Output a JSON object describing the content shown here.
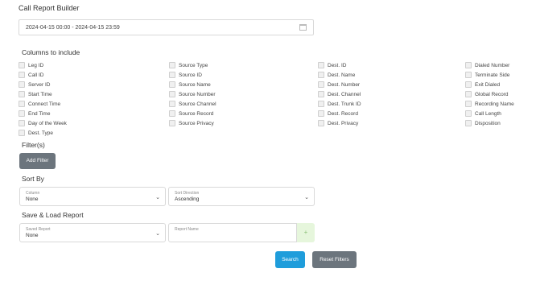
{
  "page": {
    "title": "Call Report Builder"
  },
  "date_range": {
    "value": "2024-04-15 00:00 - 2024-04-15 23:59"
  },
  "columns": {
    "heading": "Columns to include",
    "col1": [
      "Leg ID",
      "Call ID",
      "Server ID",
      "Start Time",
      "Connect Time",
      "End Time",
      "Day of the Week",
      "Dest. Type"
    ],
    "col2": [
      "Source Type",
      "Source ID",
      "Source Name",
      "Source Number",
      "Source Channel",
      "Source Record",
      "Source Privacy"
    ],
    "col3": [
      "Dest. ID",
      "Dest. Name",
      "Dest. Number",
      "Dest. Channel",
      "Dest. Trunk ID",
      "Dest. Record",
      "Dest. Privacy"
    ],
    "col4": [
      "Dialed Number",
      "Terminate Side",
      "Exit Dialed",
      "Global Record",
      "Recording Name",
      "Call Length",
      "Disposition"
    ]
  },
  "filters": {
    "heading": "Filter(s)",
    "add_label": "Add Filter"
  },
  "sort": {
    "heading": "Sort By",
    "column": {
      "label": "Column",
      "value": "None"
    },
    "direction": {
      "label": "Sort Direction",
      "value": "Ascending"
    }
  },
  "save_load": {
    "heading": "Save & Load Report",
    "saved": {
      "label": "Saved Report",
      "value": "None"
    },
    "name": {
      "placeholder": "Report Name"
    },
    "add_label": "+"
  },
  "actions": {
    "search_label": "Search",
    "reset_label": "Reset Filters"
  }
}
